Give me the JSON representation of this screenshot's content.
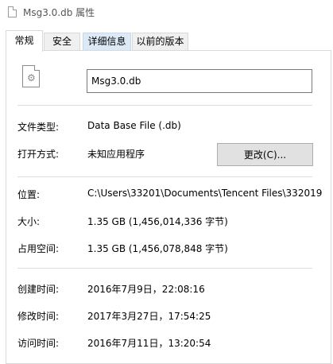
{
  "window": {
    "title": "Msg3.0.db 属性"
  },
  "tabs": [
    {
      "label": "常规"
    },
    {
      "label": "安全"
    },
    {
      "label": "详细信息"
    },
    {
      "label": "以前的版本"
    }
  ],
  "general": {
    "file_name": "Msg3.0.db",
    "file_type_label": "文件类型:",
    "file_type_value": "Data Base File (.db)",
    "opens_with_label": "打开方式:",
    "opens_with_value": "未知应用程序",
    "change_button": "更改(C)...",
    "location_label": "位置:",
    "location_value": "C:\\Users\\33201\\Documents\\Tencent Files\\332019",
    "size_label": "大小:",
    "size_value": "1.35 GB (1,456,014,336 字节)",
    "size_on_disk_label": "占用空间:",
    "size_on_disk_value": "1.35 GB (1,456,078,848 字节)",
    "created_label": "创建时间:",
    "created_value": "2016年7月9日，22:08:16",
    "modified_label": "修改时间:",
    "modified_value": "2017年3月27日，17:54:25",
    "accessed_label": "访问时间:",
    "accessed_value": "2016年7月11日，13:20:54"
  }
}
